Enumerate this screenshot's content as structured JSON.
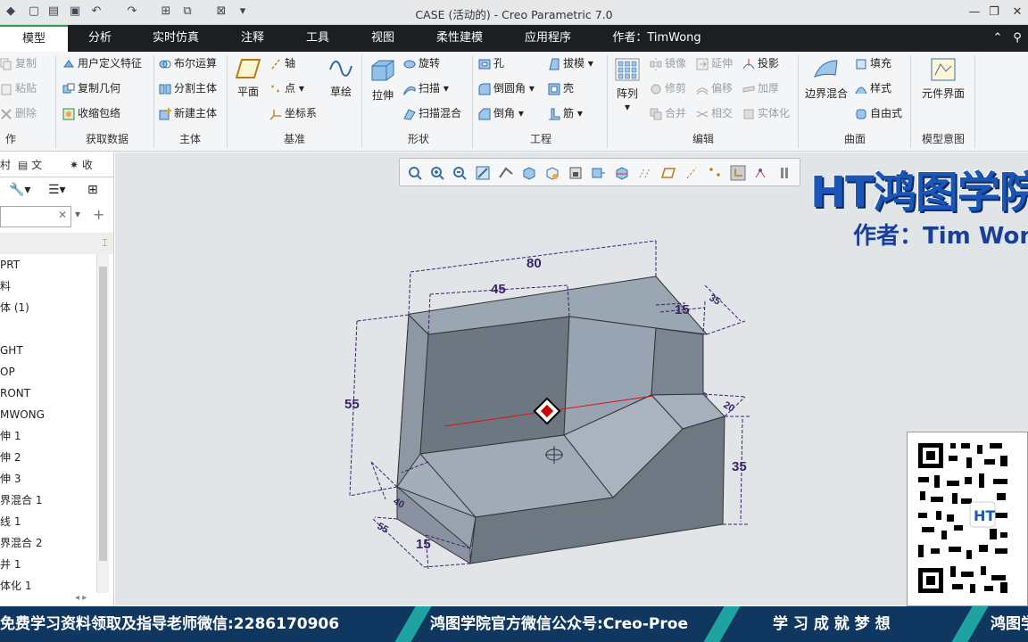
{
  "window": {
    "title": "CASE (活动的) - Creo Parametric 7.0"
  },
  "menu": {
    "tabs": [
      "模型",
      "分析",
      "实时仿真",
      "注释",
      "工具",
      "视图",
      "柔性建模",
      "应用程序"
    ],
    "author": "作者：TimWong"
  },
  "ribbon": {
    "ops": {
      "copy": "复制",
      "paste": "粘贴",
      "delete": "删除",
      "group": "作"
    },
    "getdata": {
      "udf": "用户定义特征",
      "copygeom": "复制几何",
      "shrinkwrap": "收缩包络",
      "group": "获取数据"
    },
    "body": {
      "boolean": "布尔运算",
      "split": "分割主体",
      "newbody": "新建主体",
      "group": "主体"
    },
    "datum": {
      "plane": "平面",
      "axis": "轴",
      "point": "点",
      "csys": "坐标系",
      "sketch": "草绘",
      "group": "基准"
    },
    "shapes": {
      "extrude": "拉伸",
      "revolve": "旋转",
      "sweep": "扫描",
      "swept_blend": "扫描混合",
      "group": "形状"
    },
    "engineering": {
      "hole": "孔",
      "round": "倒圆角",
      "chamfer": "倒角",
      "draft": "拔模",
      "shell": "壳",
      "rib": "筋",
      "group": "工程"
    },
    "editing": {
      "pattern": "阵列",
      "mirror": "镜像",
      "trim": "修剪",
      "merge": "合并",
      "extend": "延伸",
      "offset": "偏移",
      "intersect": "相交",
      "project": "投影",
      "thicken": "加厚",
      "solidify": "实体化",
      "group": "编辑"
    },
    "surfaces": {
      "boundary_blend": "边界混合",
      "fill": "填充",
      "style": "样式",
      "freestyle": "自由式",
      "group": "曲面"
    },
    "intent": {
      "component_interface": "元件界面",
      "group": "模型意图"
    }
  },
  "leftpanel": {
    "tabs": [
      "文",
      "收"
    ],
    "tree": [
      "PRT",
      "料",
      "体 (1)",
      "GHT",
      "OP",
      "RONT",
      "MWONG",
      "伸 1",
      "伸 2",
      "伸 3",
      "界混合 1",
      "线 1",
      "界混合 2",
      "并 1",
      "体化 1"
    ]
  },
  "model": {
    "dims": [
      "80",
      "45",
      "15",
      "35",
      "55",
      "20",
      "35",
      "40",
      "55",
      "15"
    ]
  },
  "brand": {
    "logo": "HT鸿图学院",
    "author": "作者：Tim Wong"
  },
  "banner": {
    "left": "免费学习资料领取及指导老师微信:2286170906",
    "mid": "鸿图学院官方微信公众号:Creo-Proe",
    "right": "学 习 成 就 梦 想",
    "far": "鸿图学"
  },
  "colors": {
    "accent": "#2aa14a",
    "menubar": "#1c1f22",
    "banner": "#0f3760",
    "brand": "#1a56b8"
  }
}
